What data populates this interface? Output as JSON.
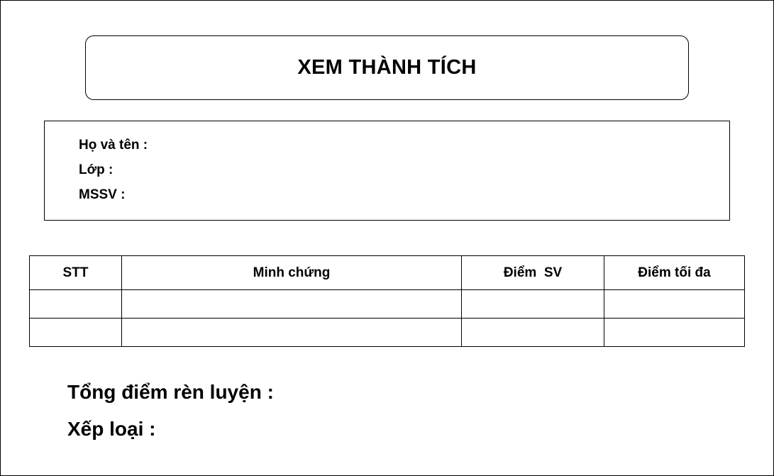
{
  "title": "XEM THÀNH TÍCH",
  "info": {
    "name_label": "Họ và tên :",
    "class_label": "Lớp :",
    "student_id_label": "MSSV :"
  },
  "table": {
    "headers": [
      "STT",
      "Minh chứng",
      "Điểm  SV",
      "Điểm tối đa"
    ],
    "rows": [
      [
        "",
        "",
        "",
        ""
      ],
      [
        "",
        "",
        "",
        ""
      ]
    ]
  },
  "summary": {
    "total_label": "Tổng điểm rèn luyện :",
    "rank_label": "Xếp loại :"
  }
}
